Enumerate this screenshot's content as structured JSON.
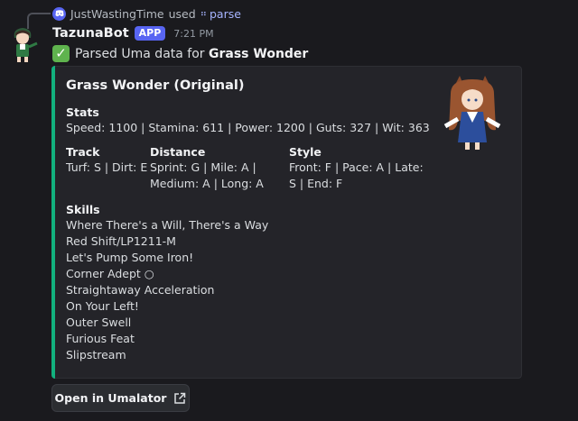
{
  "reply": {
    "user": "JustWastingTime",
    "action": "used",
    "command": "parse"
  },
  "message": {
    "bot_name": "TazunaBot",
    "badge": "APP",
    "time": "7:21 PM",
    "text_prefix": "Parsed Uma data for",
    "text_subject": "Grass Wonder"
  },
  "embed": {
    "accent_color": "#12b17e",
    "title": "Grass Wonder (Original)",
    "stats_label": "Stats",
    "stats_value": "Speed: 1100 | Stamina: 611 | Power: 1200 | Guts: 327 | Wit: 363",
    "track_label": "Track",
    "track_value": "Turf: S | Dirt: E",
    "distance_label": "Distance",
    "distance_line1": "Sprint: G | Mile: A |",
    "distance_line2": "Medium: A | Long: A",
    "style_label": "Style",
    "style_line1": "Front: F | Pace: A | Late:",
    "style_line2": "S | End: F",
    "skills_label": "Skills",
    "skills": [
      "Where There's a Will, There's a Way",
      "Red Shift/LP1211-M",
      "Let's Pump Some Iron!",
      "Corner Adept ○",
      "Straightaway Acceleration",
      "On Your Left!",
      "Outer Swell",
      "Furious Feat",
      "Slipstream"
    ]
  },
  "button": {
    "label": "Open in Umalator"
  }
}
